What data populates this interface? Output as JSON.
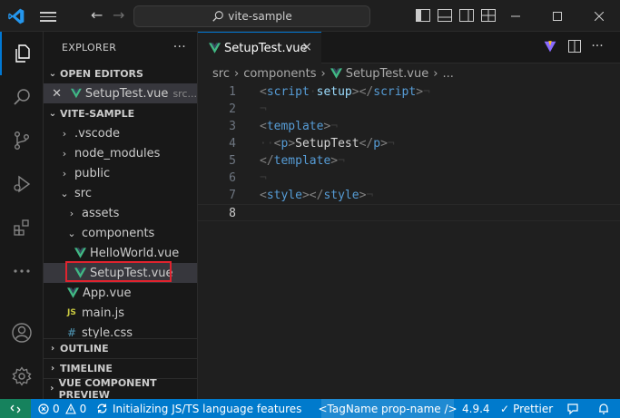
{
  "titlebar": {
    "search_text": "vite-sample"
  },
  "sidebar": {
    "title": "EXPLORER",
    "more": "···",
    "open_editors": {
      "label": "OPEN EDITORS",
      "item_name": "SetupTest.vue",
      "item_path": "src..."
    },
    "project": "VITE-SAMPLE",
    "tree": {
      "vscode": ".vscode",
      "node_modules": "node_modules",
      "public": "public",
      "src": "src",
      "assets": "assets",
      "components": "components",
      "helloworld": "HelloWorld.vue",
      "setuptest": "SetupTest.vue",
      "app": "App.vue",
      "main": "main.js",
      "style": "style.css"
    },
    "js_badge": "JS",
    "css_badge": "#",
    "outline": "OUTLINE",
    "timeline": "TIMELINE",
    "vue_preview": "VUE COMPONENT PREVIEW"
  },
  "tab": {
    "label": "SetupTest.vue",
    "close": "×"
  },
  "breadcrumb": {
    "part1": "src",
    "part2": "components",
    "part3": "SetupTest.vue",
    "part4": "..."
  },
  "editor": {
    "line_numbers": [
      "1",
      "2",
      "3",
      "4",
      "5",
      "6",
      "7",
      "8"
    ],
    "line1": {
      "open": "<",
      "tag": "script",
      "attr": "setup",
      "close": "></",
      "tag2": "script",
      "end": ">"
    },
    "line3": {
      "open": "<",
      "tag": "template",
      "end": ">"
    },
    "line4": {
      "open": "<",
      "tag": "p",
      "mid": ">",
      "text": "SetupTest",
      "close": "</",
      "tag2": "p",
      "end": ">"
    },
    "line5": {
      "open": "</",
      "tag": "template",
      "end": ">"
    },
    "line7": {
      "open": "<",
      "tag": "style",
      "close": "></",
      "tag2": "style",
      "end": ">"
    },
    "eol": "¬",
    "dot": "·"
  },
  "statusbar": {
    "errors": "0",
    "warnings": "0",
    "language_status": "Initializing JS/TS language features",
    "tag_format": "<TagName prop-name />",
    "ts_version": "4.9.4",
    "prettier": "Prettier"
  },
  "colors": {
    "accent": "#007acc",
    "vue_green": "#41b883",
    "selection_red": "#e0232e"
  }
}
